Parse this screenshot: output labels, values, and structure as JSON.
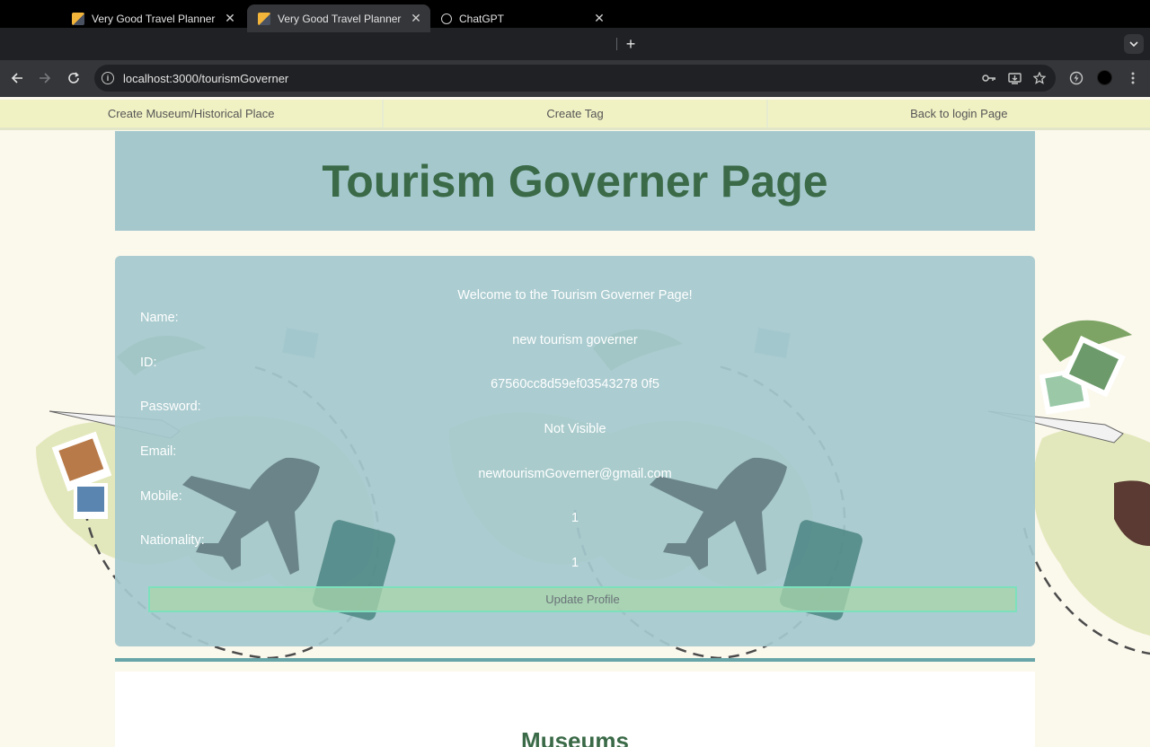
{
  "browser": {
    "tabs": [
      {
        "title": "Very Good Travel Planner",
        "active": false,
        "icon": "app-favicon-icon"
      },
      {
        "title": "Very Good Travel Planner",
        "active": true,
        "icon": "app-favicon-icon"
      },
      {
        "title": "ChatGPT",
        "active": false,
        "icon": "chatgpt-favicon-icon"
      }
    ],
    "close_glyph": "✕",
    "newtab_glyph": "+",
    "url": "localhost:3000/tourismGoverner"
  },
  "navbar": {
    "items": [
      "Create Museum/Historical Place",
      "Create Tag",
      "Back to login Page"
    ]
  },
  "header": {
    "title": "Tourism Governer Page"
  },
  "profile": {
    "welcome": "Welcome to the Tourism Governer Page!",
    "fields": [
      {
        "label": "Name:",
        "value": "new tourism governer"
      },
      {
        "label": "ID:",
        "value": "67560cc8d59ef03543278 0f5"
      },
      {
        "label": "Password:",
        "value": "Not Visible"
      },
      {
        "label": "Email:",
        "value": "newtourismGoverner@gmail.com"
      },
      {
        "label": "Mobile:",
        "value": "1"
      },
      {
        "label": "Nationality:",
        "value": "1"
      }
    ],
    "update_button": "Update Profile"
  },
  "museums": {
    "title": "Museums"
  },
  "colors": {
    "header_bg": "#a5c8cd",
    "title_green": "#3a6a47",
    "navbar_bg": "#f1f2c4",
    "page_bg": "#fbf8ec",
    "divider": "#67a5a8"
  }
}
